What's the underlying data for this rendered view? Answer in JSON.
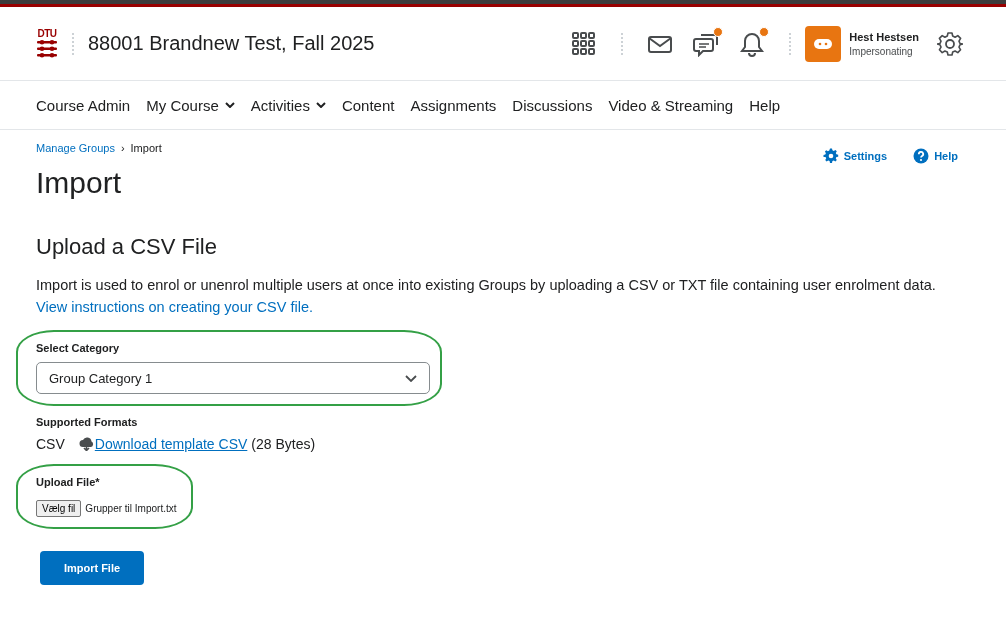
{
  "header": {
    "logo_text": "DTU",
    "course_title": "88001 Brandnew Test, Fall 2025",
    "icons": [
      {
        "kind": "grid",
        "badge": false
      },
      {
        "kind": "mail",
        "badge": false
      },
      {
        "kind": "chat",
        "badge": true
      },
      {
        "kind": "bell",
        "badge": true
      }
    ],
    "user": {
      "name": "Hest Hestsen",
      "role": "Impersonating"
    }
  },
  "nav": [
    {
      "label": "Course Admin",
      "dropdown": false
    },
    {
      "label": "My Course",
      "dropdown": true
    },
    {
      "label": "Activities",
      "dropdown": true
    },
    {
      "label": "Content",
      "dropdown": false
    },
    {
      "label": "Assignments",
      "dropdown": false
    },
    {
      "label": "Discussions",
      "dropdown": false
    },
    {
      "label": "Video & Streaming",
      "dropdown": false
    },
    {
      "label": "Help",
      "dropdown": false
    }
  ],
  "breadcrumb": {
    "parent": "Manage Groups",
    "separator": "›",
    "current": "Import"
  },
  "page_actions": [
    {
      "kind": "settings",
      "label": "Settings"
    },
    {
      "kind": "help",
      "label": "Help"
    }
  ],
  "title": "Import",
  "section_title": "Upload a CSV File",
  "description": "Import is used to enrol or unenrol multiple users at once into existing Groups by uploading a CSV or TXT file containing user enrolment data.",
  "description_link": "View instructions on creating your CSV file.",
  "category": {
    "label": "Select Category",
    "value": "Group Category 1",
    "highlighted": true
  },
  "formats": {
    "label": "Supported Formats",
    "format": "CSV",
    "link": "Download template CSV",
    "size": "(28 Bytes)"
  },
  "upload": {
    "label": "Upload File*",
    "button": "Vælg fil",
    "file_name": "Grupper til Import.txt",
    "highlighted": true
  },
  "submit": "Import File"
}
